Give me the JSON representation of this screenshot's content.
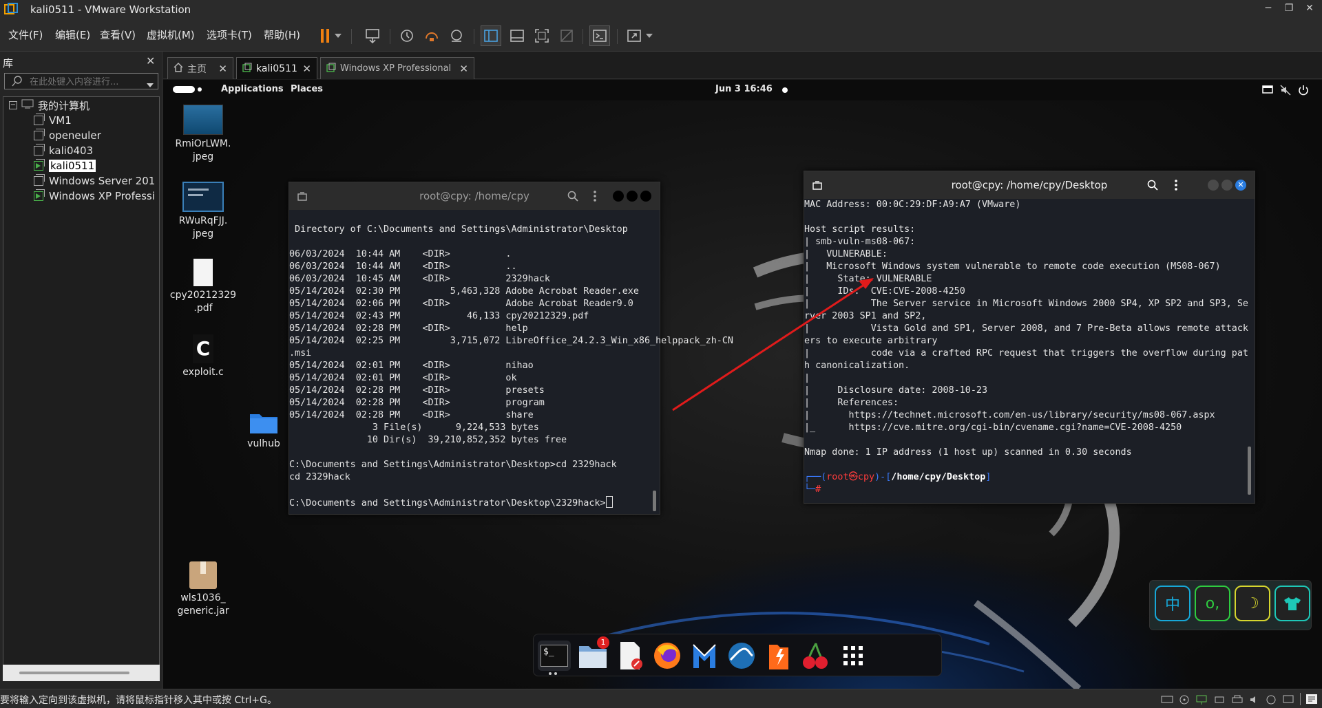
{
  "window": {
    "title": "kali0511 - VMware Workstation",
    "min": "─",
    "max": "❐",
    "close": "✕"
  },
  "menu": [
    {
      "label": "文件(F)"
    },
    {
      "label": "编辑(E)"
    },
    {
      "label": "查看(V)"
    },
    {
      "label": "虚拟机(M)"
    },
    {
      "label": "选项卡(T)"
    },
    {
      "label": "帮助(H)"
    }
  ],
  "library": {
    "title": "库",
    "close": "✕",
    "search_placeholder": "在此处键入内容进行...",
    "root": "我的计算机",
    "items": [
      {
        "label": "VM1",
        "running": false
      },
      {
        "label": "openeuler",
        "running": false
      },
      {
        "label": "kali0403",
        "running": false
      },
      {
        "label": "kali0511",
        "running": true,
        "selected": true
      },
      {
        "label": "Windows Server 201",
        "running": false
      },
      {
        "label": "Windows XP Professi",
        "running": true
      }
    ]
  },
  "tabs": [
    {
      "label": "主页"
    },
    {
      "label": "kali0511"
    },
    {
      "label": "Windows XP Professional"
    }
  ],
  "guest": {
    "topbar": {
      "applications": "Applications",
      "places": "Places",
      "datetime": "Jun 3  16:46"
    },
    "desktop_icons": [
      {
        "label1": "RmiOrLWM.",
        "label2": "jpeg"
      },
      {
        "label1": "RWuRqFJJ.",
        "label2": "jpeg"
      },
      {
        "label1": "cpy20212329",
        "label2": ".pdf"
      },
      {
        "label1": "exploit.c",
        "label2": ""
      },
      {
        "label1": "vulhub",
        "label2": ""
      },
      {
        "label1": "wls1036_",
        "label2": "generic.jar"
      }
    ],
    "exploit_glyph": "C",
    "term_left": {
      "title": "root@cpy: /home/cpy",
      "lines": [
        "",
        " Directory of C:\\Documents and Settings\\Administrator\\Desktop",
        "",
        "06/03/2024  10:44 AM    <DIR>          .",
        "06/03/2024  10:44 AM    <DIR>          ..",
        "06/03/2024  10:45 AM    <DIR>          2329hack",
        "05/14/2024  02:30 PM         5,463,328 Adobe Acrobat Reader.exe",
        "05/14/2024  02:06 PM    <DIR>          Adobe Acrobat Reader9.0",
        "05/14/2024  02:43 PM            46,133 cpy20212329.pdf",
        "05/14/2024  02:28 PM    <DIR>          help",
        "05/14/2024  02:25 PM         3,715,072 LibreOffice_24.2.3_Win_x86_helppack_zh-CN",
        ".msi",
        "05/14/2024  02:01 PM    <DIR>          nihao",
        "05/14/2024  02:01 PM    <DIR>          ok",
        "05/14/2024  02:28 PM    <DIR>          presets",
        "05/14/2024  02:28 PM    <DIR>          program",
        "05/14/2024  02:28 PM    <DIR>          share",
        "               3 File(s)      9,224,533 bytes",
        "              10 Dir(s)  39,210,852,352 bytes free",
        "",
        "C:\\Documents and Settings\\Administrator\\Desktop>cd 2329hack",
        "cd 2329hack",
        "",
        "C:\\Documents and Settings\\Administrator\\Desktop\\2329hack>"
      ]
    },
    "term_right": {
      "title": "root@cpy: /home/cpy/Desktop",
      "lines": [
        "MAC Address: 00:0C:29:DF:A9:A7 (VMware)",
        "",
        "Host script results:",
        "| smb-vuln-ms08-067:",
        "|   VULNERABLE:",
        "|   Microsoft Windows system vulnerable to remote code execution (MS08-067)",
        "|     State: VULNERABLE",
        "|     IDs:  CVE:CVE-2008-4250",
        "|           The Server service in Microsoft Windows 2000 SP4, XP SP2 and SP3, Se",
        "rver 2003 SP1 and SP2,",
        "|           Vista Gold and SP1, Server 2008, and 7 Pre-Beta allows remote attack",
        "ers to execute arbitrary",
        "|           code via a crafted RPC request that triggers the overflow during pat",
        "h canonicalization.",
        "|",
        "|     Disclosure date: 2008-10-23",
        "|     References:",
        "|       https://technet.microsoft.com/en-us/library/security/ms08-067.aspx",
        "|_      https://cve.mitre.org/cgi-bin/cvename.cgi?name=CVE-2008-4250",
        "",
        "Nmap done: 1 IP address (1 host up) scanned in 0.30 seconds",
        ""
      ],
      "prompt_user": "root",
      "prompt_at": "㉿",
      "prompt_host": "cpy",
      "prompt_path": "/home/cpy/Desktop",
      "prompt_hash": "#"
    },
    "dock_badge": "1",
    "terminal_glyph": "$_",
    "widget": [
      {
        "glyph": "中",
        "color": "#17a8d8"
      },
      {
        "glyph": "o,",
        "color": "#2ecc40"
      },
      {
        "glyph": "☽",
        "color": "#d6d62e"
      },
      {
        "glyph": "👕",
        "color": "#1ec8b8"
      }
    ]
  },
  "status": {
    "message": "要将输入定向到该虚拟机，请将鼠标指针移入其中或按 Ctrl+G。"
  },
  "colors": {
    "prompt_red": "#ff3c3c",
    "prompt_blue": "#3a7bff",
    "arrow_red": "#e01b1b"
  }
}
